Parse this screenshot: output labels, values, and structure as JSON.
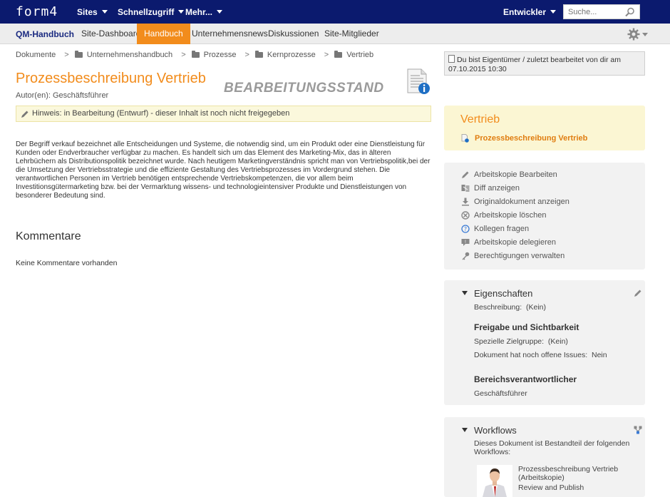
{
  "topbar": {
    "logo": "form4",
    "nav": [
      "Sites",
      "Schnellzugriff",
      "Mehr..."
    ],
    "user": "Entwickler",
    "search_placeholder": "Suche..."
  },
  "subnav": {
    "site_title": "QM-Handbuch",
    "tabs": [
      "Site-Dashboard",
      "Handbuch",
      "Unternehmensnews",
      "Diskussionen",
      "Site-Mitglieder"
    ],
    "active_tab": "Handbuch"
  },
  "breadcrumb": [
    "Dokumente",
    "Unternehmenshandbuch",
    "Prozesse",
    "Kernprozesse",
    "Vertrieb"
  ],
  "doc": {
    "title": "Prozessbeschreibung Vertrieb",
    "authors": "Autor(en): Geschäftsführer",
    "stamp": "BEARBEITUNGSSTAND",
    "notice": "Hinweis: in Bearbeitung (Entwurf) - dieser Inhalt ist noch nicht freigegeben",
    "body": "Der Begriff  verkauf bezeichnet alle Entscheidungen und Systeme, die notwendig sind, um ein Produkt oder eine Dienstleistung für Kunden oder Endverbraucher verfügbar zu machen. Es handelt sich um das Element des Marketing-Mix, das in älteren Lehrbüchern als Distributionspolitik bezeichnet wurde. Nach heutigem Marketingverständnis spricht man von Vertriebspolitik,bei der die Umsetzung der Vertriebsstrategie und die effiziente Gestaltung des Vertriebsprozesses im Vordergrund stehen. Die verantwortlichen Personen im Vertrieb benötigen entsprechende Vertriebskompetenzen, die vor allem beim Investitionsgütermarketing bzw. bei der Vermarktung wissens- und technologieintensiver Produkte und Dienstleistungen von besonderer Bedeutung sind."
  },
  "comments": {
    "heading": "Kommentare",
    "empty": "Keine Kommentare vorhanden"
  },
  "owner": {
    "text": "Du bist Eigentümer / zuletzt bearbeitet von dir am 07.10.2015 10:30"
  },
  "folder_card": {
    "heading": "Vertrieb",
    "link": "Prozessbeschreibung Vertrieb"
  },
  "actions": [
    {
      "label": "Arbeitskopie Bearbeiten",
      "icon": "pencil-icon"
    },
    {
      "label": "Diff anzeigen",
      "icon": "diff-icon"
    },
    {
      "label": "Originaldokument anzeigen",
      "icon": "download-icon"
    },
    {
      "label": "Arbeitskopie löschen",
      "icon": "delete-icon"
    },
    {
      "label": "Kollegen fragen",
      "icon": "help-icon"
    },
    {
      "label": "Arbeitskopie delegieren",
      "icon": "delegate-icon"
    },
    {
      "label": "Berechtigungen verwalten",
      "icon": "key-icon"
    }
  ],
  "properties": {
    "heading": "Eigenschaften",
    "beschreibung_label": "Beschreibung:",
    "beschreibung_value": "(Kein)",
    "freigabe_heading": "Freigabe und Sichtbarkeit",
    "zielgruppe_label": "Spezielle Zielgruppe:",
    "zielgruppe_value": "(Kein)",
    "issues_label": "Dokument hat noch offene Issues:",
    "issues_value": "Nein",
    "verantwortlicher_heading": "Bereichsverantwortlicher",
    "verantwortlicher_value": "Geschäftsführer"
  },
  "workflows": {
    "heading": "Workflows",
    "description": "Dieses Dokument ist Bestandteil der folgenden Workflows:",
    "item_name": "Prozessbeschreibung Vertrieb (Arbeitskopie)",
    "item_type": "Review and Publish"
  }
}
